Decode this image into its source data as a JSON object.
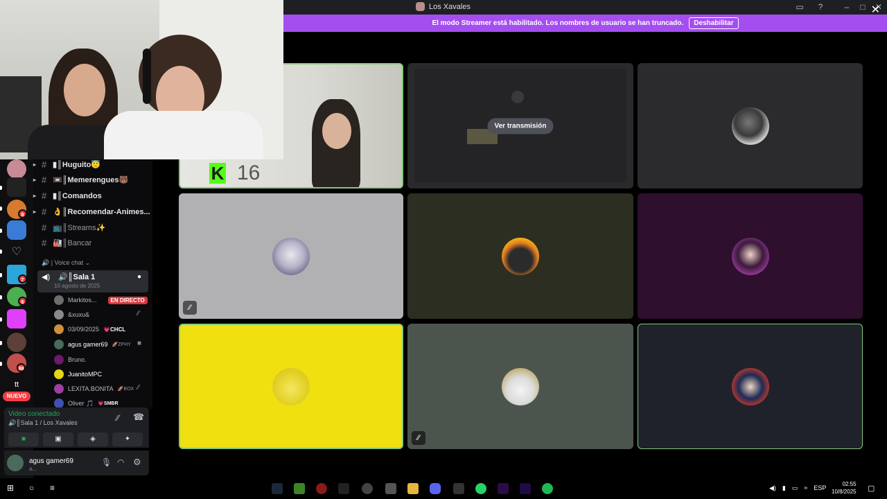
{
  "window": {
    "title": "Los Xavales"
  },
  "banner": {
    "text": "El modo Streamer está habilitado. Los nombres de usuario se han truncado.",
    "button": "Deshabilitar"
  },
  "servers": {
    "badges": [
      "8",
      "7",
      "6",
      "99"
    ],
    "new_label": "NUEVO",
    "tt_label": "tt"
  },
  "channels": [
    {
      "name": "▮║Huguito😇"
    },
    {
      "name": "📼║Memerengues🐻"
    },
    {
      "name": "▮║Comandos"
    },
    {
      "name": "👌║Recomendar-Animes..."
    },
    {
      "name": "📺║Streams✨"
    },
    {
      "name": "🏭║Bancar"
    }
  ],
  "voice": {
    "category": "🔊 | Voice chat",
    "room_name": "🔊║Sala 1",
    "room_date": "10 agosto de 2025",
    "members": [
      {
        "name": "Markitos...",
        "tag": "EN DIRECTO"
      },
      {
        "name": "&xuxu&",
        "tag": ""
      },
      {
        "name": "03/09/2025",
        "tag": "💗CHCL"
      },
      {
        "name": "agus gamer69",
        "tag": "🚀ZPHY"
      },
      {
        "name": "Bruno.",
        "tag": ""
      },
      {
        "name": "JuanitoMPC",
        "tag": ""
      },
      {
        "name": "LEXITA.BONITA",
        "tag": "🚀BOX"
      },
      {
        "name": "Oliver 🎵",
        "tag": "💗SMBR"
      }
    ]
  },
  "connection": {
    "status": "Video conectado",
    "location": "🔊║Sala 1 / Los Xavales"
  },
  "user": {
    "name": "agus gamer69",
    "status": "a..."
  },
  "grid": {
    "watch_label": "Ver transmisión",
    "overlay_number": "16",
    "overlay_letter": "K"
  },
  "taskbar": {
    "lang": "ESP",
    "time": "02:55",
    "date": "10/8/2025"
  },
  "colors": {
    "banner": "#a54ef0",
    "live": "#da373c",
    "connected": "#23a55a",
    "speaking_border": "#86c97a"
  }
}
